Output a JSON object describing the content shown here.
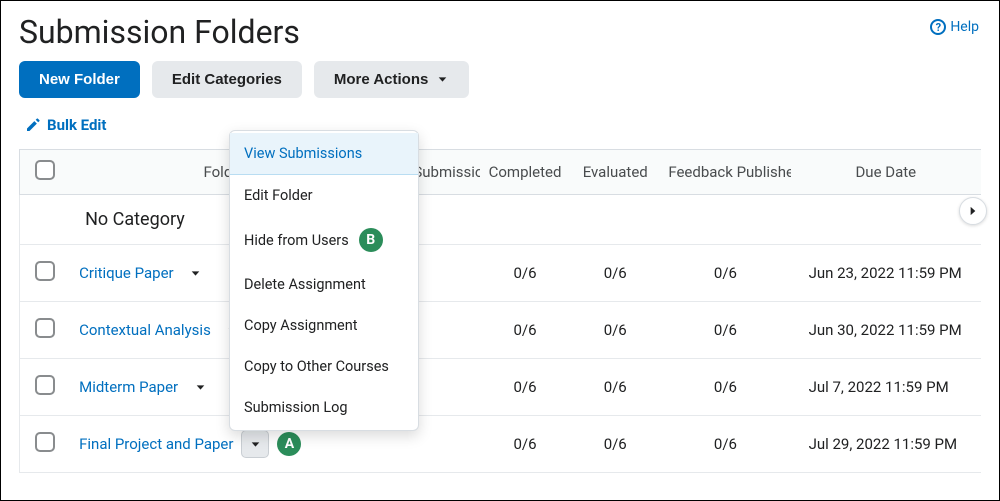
{
  "page": {
    "title": "Submission Folders"
  },
  "help": {
    "label": "Help"
  },
  "toolbar": {
    "new_folder": "New Folder",
    "edit_categories": "Edit Categories",
    "more_actions": "More Actions"
  },
  "bulk_edit": {
    "label": "Bulk Edit"
  },
  "columns": {
    "folder": "Folder",
    "new_submissions": "New Submissions",
    "completed": "Completed",
    "evaluated": "Evaluated",
    "feedback_published": "Feedback Published",
    "due_date": "Due Date"
  },
  "category": {
    "name": "No Category"
  },
  "rows": [
    {
      "name": "Critique Paper",
      "completed": "0/6",
      "evaluated": "0/6",
      "feedback": "0/6",
      "due": "Jun 23, 2022 11:59 PM",
      "badge": "",
      "active": false
    },
    {
      "name": "Contextual Analysis",
      "completed": "0/6",
      "evaluated": "0/6",
      "feedback": "0/6",
      "due": "Jun 30, 2022 11:59 PM",
      "badge": "",
      "active": false
    },
    {
      "name": "Midterm Paper",
      "completed": "0/6",
      "evaluated": "0/6",
      "feedback": "0/6",
      "due": "Jul 7, 2022 11:59 PM",
      "badge": "",
      "active": false
    },
    {
      "name": "Final Project and Paper",
      "completed": "0/6",
      "evaluated": "0/6",
      "feedback": "0/6",
      "due": "Jul 29, 2022 11:59 PM",
      "badge": "A",
      "active": true
    }
  ],
  "menu": {
    "view_submissions": "View Submissions",
    "edit_folder": "Edit Folder",
    "hide_from_users": "Hide from Users",
    "hide_badge": "B",
    "delete_assignment": "Delete Assignment",
    "copy_assignment": "Copy Assignment",
    "copy_to_other": "Copy to Other Courses",
    "submission_log": "Submission Log"
  }
}
